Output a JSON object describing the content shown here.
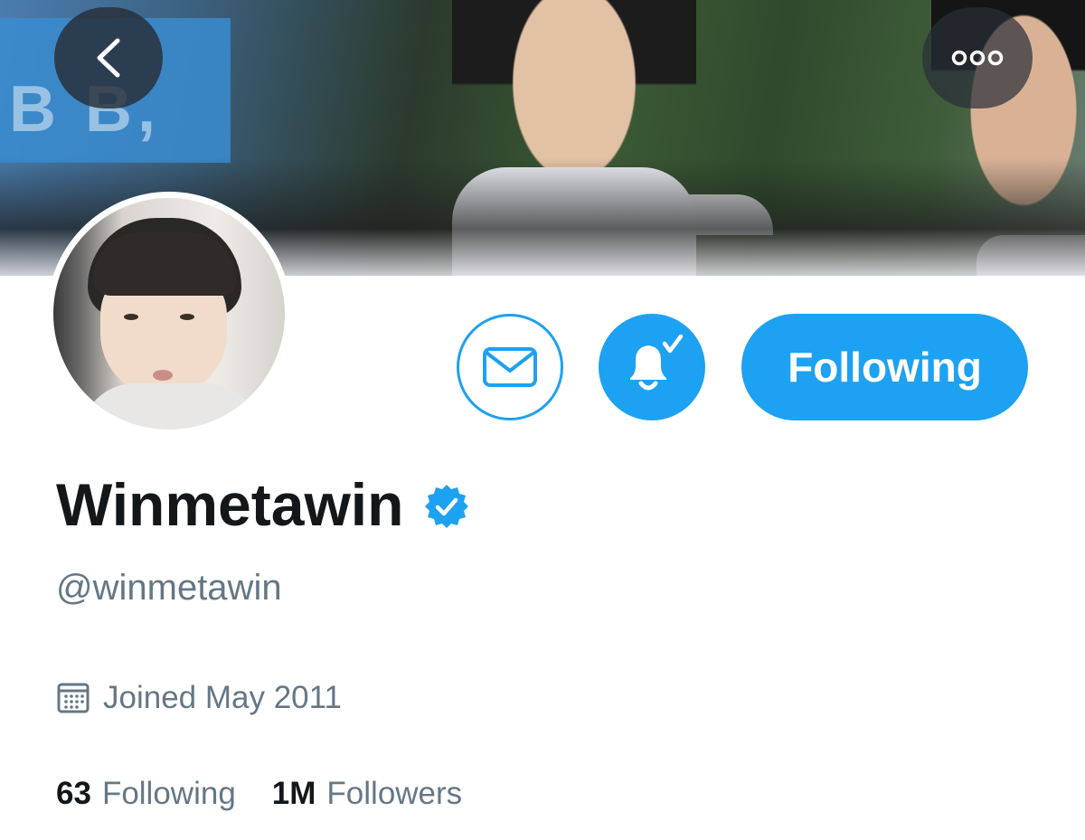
{
  "header": {
    "back_icon": "chevron-left-icon",
    "more_icon": "more-horizontal-icon",
    "banner_sign_text": "B B,"
  },
  "actions": {
    "message_icon": "envelope-icon",
    "notifications_icon": "bell-check-icon",
    "follow_label": "Following"
  },
  "profile": {
    "display_name": "Winmetawin",
    "verified": true,
    "handle": "@winmetawin",
    "joined_icon": "calendar-icon",
    "joined": "Joined May 2011"
  },
  "stats": {
    "following_count": "63",
    "following_label": "Following",
    "followers_count": "1M",
    "followers_label": "Followers"
  },
  "colors": {
    "accent": "#1da1f2",
    "text_primary": "#14171a",
    "text_secondary": "#657786"
  }
}
